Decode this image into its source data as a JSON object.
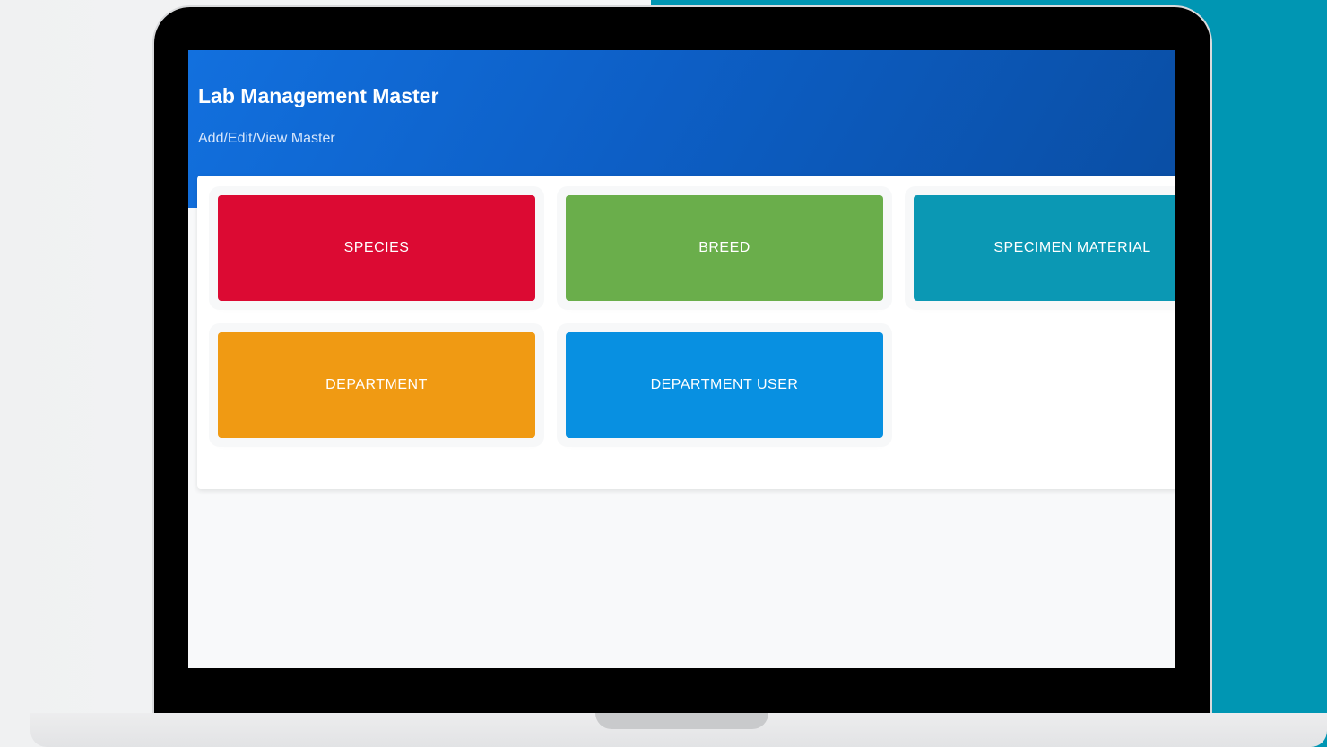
{
  "page": {
    "title": "Lab Management Master",
    "subtitle": "Add/Edit/View Master"
  },
  "tiles": [
    {
      "label": "SPECIES",
      "color": "#dc0a33"
    },
    {
      "label": "BREED",
      "color": "#6aae4b"
    },
    {
      "label": "SPECIMEN MATERIAL",
      "color": "#0b98b4"
    },
    {
      "label": "DEPARTMENT",
      "color": "#f09a13"
    },
    {
      "label": "DEPARTMENT USER",
      "color": "#0890e1"
    }
  ],
  "colors": {
    "header_start": "#1270de",
    "header_end": "#0a4ea4",
    "backdrop_accent": "#0096b3"
  }
}
